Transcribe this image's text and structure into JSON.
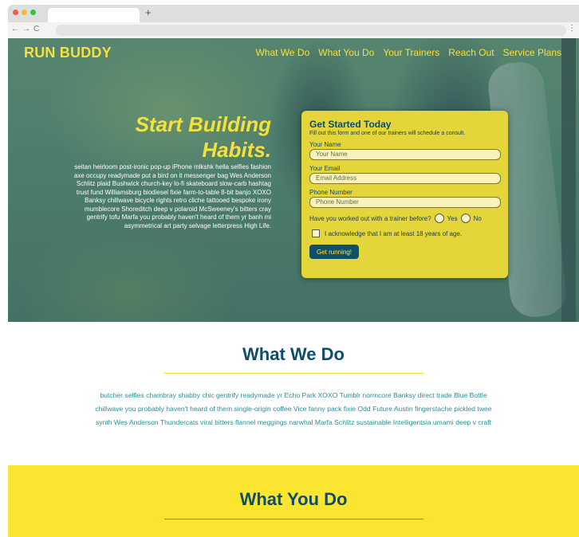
{
  "browser": {
    "new_tab_symbol": "+",
    "back_icon": "←",
    "forward_icon": "→",
    "reload_icon": "C",
    "menu_icon": "⋮",
    "dot_colors": [
      "#ef5b55",
      "#f5bd2c",
      "#2ec543"
    ]
  },
  "header": {
    "brand": "RUN BUDDY",
    "nav": [
      "What We Do",
      "What You Do",
      "Your Trainers",
      "Reach Out",
      "Service Plans"
    ]
  },
  "hero": {
    "title_line1": "Start Building",
    "title_line2": "Habits.",
    "body": "seitan heirloom post-ironic pop-up iPhone mlkshk hella selfies fashion axe occupy readymade put a bird on it messenger bag Wes Anderson Schlitz plaid Bushwick church-key lo-fi skateboard slow-carb hashtag trust fund Williamsburg biodiesel fixie farm-to-table 8-bit banjo XOXO Banksy chillwave bicycle rights retro cliche tattooed bespoke irony mumblecore Shoreditch deep v polaroid McSweeney's bitters cray gentrify tofu Marfa you probably haven't heard of them yr banh mi asymmetrical art party selvage letterpress High Life."
  },
  "form": {
    "title": "Get Started Today",
    "subtitle": "Fill out this form and one of our trainers will schedule a consult.",
    "name_label": "Your Name",
    "name_placeholder": "Your Name",
    "email_label": "Your Email",
    "email_placeholder": "Email Address",
    "phone_label": "Phone Number",
    "phone_placeholder": "Phone Number",
    "question": "Have you worked out with a trainer before?",
    "yes": "Yes",
    "no": "No",
    "acknowledge": "I acknowledge that I am at least 18 years of age.",
    "submit": "Get running!"
  },
  "what_we_do": {
    "title": "What We Do",
    "text": "butcher selfies chambray shabby chic gentrify readymade yr Echo Park XOXO Tumblr normcore Banksy direct trade Blue Bottle chillwave you probably haven't heard of them single-origin coffee Vice fanny pack fixie Odd Future Austin fingerstache pickled twee synth Wes Anderson Thundercats viral bitters flannel meggings narwhal Marfa Schlitz sustainable Intelligentsia umami deep v craft"
  },
  "what_you_do": {
    "title": "What You Do"
  },
  "colors": {
    "brand_yellow": "#f5e13c",
    "navy": "#0e4d6c",
    "teal_text": "#2b8f96",
    "section_yellow": "#fbe531",
    "rule_yellow": "#f5d83a",
    "rule_teal": "#3a98b8"
  }
}
